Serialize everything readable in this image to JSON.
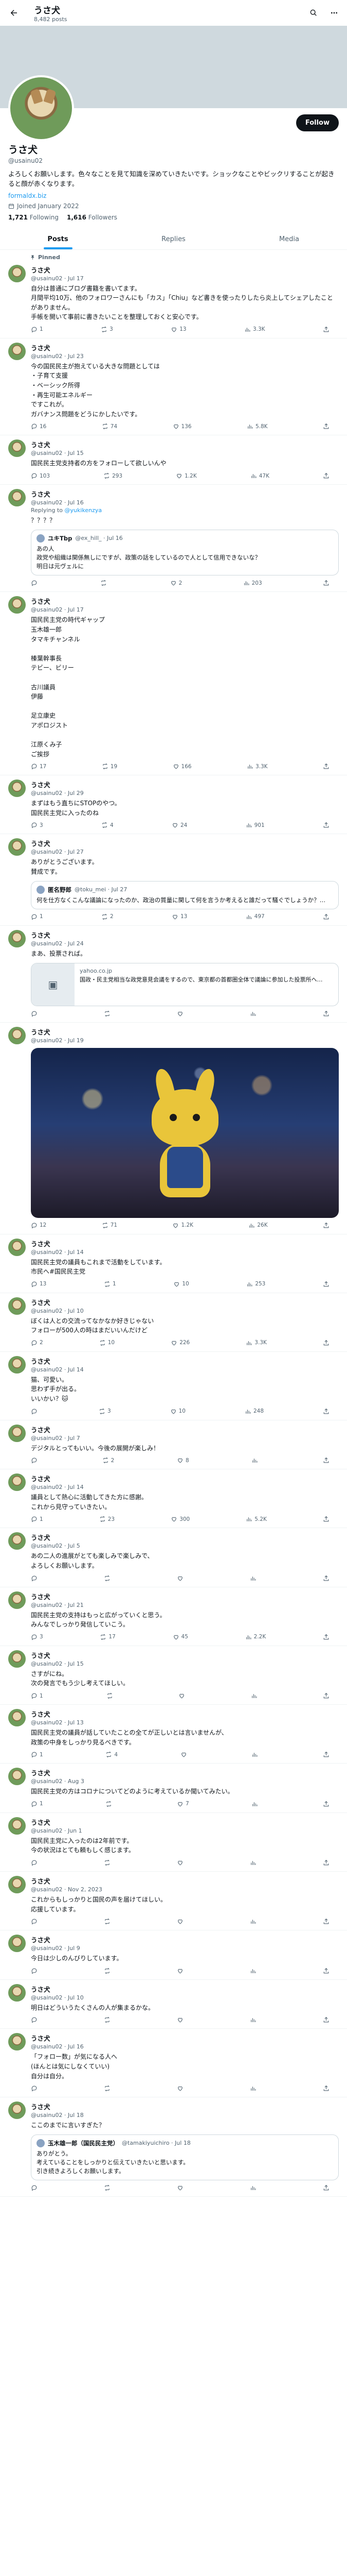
{
  "header": {
    "name": "うさ犬",
    "post_count": "8,482 posts"
  },
  "profile": {
    "display_name": "うさ犬",
    "handle": "@usainu02",
    "bio": "よろしくお願いします。色々なことを見て知識を深めていきたいです。ショックなことやビックリすることが起きると顔が赤くなります。",
    "link": "formaldx.biz",
    "joined": "Joined January 2022",
    "following_count": "1,721",
    "following_label": "Following",
    "followers_count": "1,616",
    "followers_label": "Followers",
    "follow_button": "Follow"
  },
  "tabs": [
    "Posts",
    "Replies",
    "Media"
  ],
  "pinned_label": "Pinned",
  "tweets": [
    {
      "name": "うさ犬",
      "meta": "@usainu02 · Jul 17",
      "text": "自分は普通にブログ書籍を書いてます。\n月間平均10万、他のフォロワーさんにも「カス」「Chiu」など書きを使ったりしたら炎上してシェアしたことがありません。\n手帳を開いて事前に書きたいことを整理しておくと安心です。",
      "replies": "1",
      "reposts": "3",
      "likes": "13",
      "views": "3.3K"
    },
    {
      "name": "うさ犬",
      "meta": "@usainu02 · Jul 23",
      "text": "今の国民民主が抱えている大きな問題としては\n・子育て支援\n・ベーシック所得\n・再生可能エネルギー\nですこれが。\nガバナンス問題をどうにかしたいです。",
      "replies": "16",
      "reposts": "74",
      "likes": "136",
      "views": "5.8K"
    },
    {
      "name": "うさ犬",
      "meta": "@usainu02 · Jul 15",
      "text": "国民民主党支持者の方をフォローして欲しいんや",
      "replies": "103",
      "reposts": "293",
      "likes": "1.2K",
      "views": "47K"
    },
    {
      "name": "うさ犬",
      "meta": "@usainu02 · Jul 16",
      "reply_to": "@yukikenzya",
      "text": "？？？？",
      "quote_name": "ユキTbp",
      "quote_meta": "@ex_hill_ · Jul 16",
      "quote_text": "あの人\n政党や組織は関係無しにですが、政策の話をしているので人として信用できないな？\n明日は元ヴェルに",
      "replies": "",
      "reposts": "",
      "likes": "2",
      "views": "203"
    },
    {
      "name": "うさ犬",
      "meta": "@usainu02 · Jul 17",
      "text": "国民民主党の時代ギャップ\n玉木雄一郎\nタマキチャンネル\n\n榛葉幹事長\nテビー、ビリー\n\n古川議員\n伊藤\n\n足立康史\nアポロジスト\n\n江原くみ子\nご挨拶",
      "replies": "17",
      "reposts": "19",
      "likes": "166",
      "views": "3.3K"
    },
    {
      "name": "うさ犬",
      "meta": "@usainu02 · Jul 29",
      "text": "まずはもう直ちにSTOPのやつ。\n国民民主党に入ったのね",
      "replies": "3",
      "reposts": "4",
      "likes": "24",
      "views": "901"
    },
    {
      "name": "うさ犬",
      "meta": "@usainu02 · Jul 27",
      "text": "ありがとうございます。\n賛成です。",
      "quote_name": "匿名野郎",
      "quote_meta": "@toku_mei · Jul 27",
      "quote_text": "何を仕方なくこんな議論になったのか、政治の質量に関して何を言うか考えると誰だって騒ぐでしょうか？…",
      "replies": "1",
      "reposts": "2",
      "likes": "13",
      "views": "497"
    },
    {
      "name": "うさ犬",
      "meta": "@usainu02 · Jul 24",
      "text": "まあ、投票されば。",
      "card_domain": "yahoo.co.jp",
      "card_title": "国政・民主党相当な政党意見会議をするので、東京都の首都圏全体で議論に参加した投票所へ…",
      "replies": "",
      "reposts": "",
      "likes": "",
      "views": ""
    },
    {
      "name": "うさ犬",
      "meta": "@usainu02 · Jul 19",
      "text": "",
      "has_media": true,
      "replies": "12",
      "reposts": "71",
      "likes": "1.2K",
      "views": "26K"
    },
    {
      "name": "うさ犬",
      "meta": "@usainu02 · Jul 14",
      "text": "国民民主党の議員もこれまで活動をしています。\n市民へ#国民民主党",
      "replies": "13",
      "reposts": "1",
      "likes": "10",
      "views": "253"
    },
    {
      "name": "うさ犬",
      "meta": "@usainu02 · Jul 10",
      "text": "ぼくは人との交流ってなかなか好きじゃない\nフォローが500人の時はまだいいんだけど",
      "replies": "2",
      "reposts": "10",
      "likes": "226",
      "views": "3.3K"
    },
    {
      "name": "うさ犬",
      "meta": "@usainu02 · Jul 14",
      "text": "猫、可愛い。\n思わず手が出る。\nいいかい？🐱",
      "replies": "",
      "reposts": "3",
      "likes": "10",
      "views": "248"
    },
    {
      "name": "うさ犬",
      "meta": "@usainu02 · Jul 7",
      "text": "デジタルとってもいい。今後の展開が楽しみ！",
      "replies": "",
      "reposts": "2",
      "likes": "8",
      "views": ""
    },
    {
      "name": "うさ犬",
      "meta": "@usainu02 · Jul 14",
      "text": "議員として熱心に活動してきた方に感謝。\nこれから見守っていきたい。",
      "replies": "1",
      "reposts": "23",
      "likes": "300",
      "views": "5.2K"
    },
    {
      "name": "うさ犬",
      "meta": "@usainu02 · Jul 5",
      "text": "あの二人の進展がとても楽しみで楽しみで、\nよろしくお願いします。",
      "replies": "",
      "reposts": "",
      "likes": "",
      "views": ""
    },
    {
      "name": "うさ犬",
      "meta": "@usainu02 · Jul 21",
      "text": "国民民主党の支持はもっと広がっていくと思う。\nみんなでしっかり発信していこう。",
      "replies": "3",
      "reposts": "17",
      "likes": "45",
      "views": "2.2K"
    },
    {
      "name": "うさ犬",
      "meta": "@usainu02 · Jul 15",
      "text": "さすがにね。\n次の発言でもう少し考えてほしい。",
      "replies": "1",
      "reposts": "",
      "likes": "",
      "views": ""
    },
    {
      "name": "うさ犬",
      "meta": "@usainu02 · Jul 13",
      "text": "国民民主党の議員が話していたことの全てが正しいとは言いませんが、\n政策の中身をしっかり見るべきです。",
      "replies": "1",
      "reposts": "4",
      "likes": "",
      "views": ""
    },
    {
      "name": "うさ犬",
      "meta": "@usainu02 · Aug 3",
      "text": "国民民主党の方はコロナについてどのように考えているか聞いてみたい。",
      "replies": "1",
      "reposts": "",
      "likes": "7",
      "views": ""
    },
    {
      "name": "うさ犬",
      "meta": "@usainu02 · Jun 1",
      "text": "国民民主党に入ったのは2年前です。\n今の状況はとても頼もしく感じます。",
      "replies": "",
      "reposts": "",
      "likes": "",
      "views": ""
    },
    {
      "name": "うさ犬",
      "meta": "@usainu02 · Nov 2, 2023",
      "text": "これからもしっかりと国民の声を届けてほしい。\n応援しています。",
      "replies": "",
      "reposts": "",
      "likes": "",
      "views": ""
    },
    {
      "name": "うさ犬",
      "meta": "@usainu02 · Jul 9",
      "text": "今日は少しのんびりしています。",
      "replies": "",
      "reposts": "",
      "likes": "",
      "views": ""
    },
    {
      "name": "うさ犬",
      "meta": "@usainu02 · Jul 10",
      "text": "明日はどういうたくさんの人が集まるかな。",
      "replies": "",
      "reposts": "",
      "likes": "",
      "views": ""
    },
    {
      "name": "うさ犬",
      "meta": "@usainu02 · Jul 16",
      "text": "「フォロー数」が気になる人へ\n(ほんとは気にしなくていい)\n自分は自分。",
      "replies": "",
      "reposts": "",
      "likes": "",
      "views": ""
    },
    {
      "name": "うさ犬",
      "meta": "@usainu02 · Jul 18",
      "text": "ここのまでに言いすぎた？",
      "quote_name": "玉木雄一郎（国民民主党）",
      "quote_meta": "@tamakiyuichiro · Jul 18",
      "quote_text": "ありがとう。\n考えていることをしっかりと伝えていきたいと思います。\n引き続きよろしくお願いします。",
      "replies": "",
      "reposts": "",
      "likes": "",
      "views": ""
    }
  ],
  "icons": {
    "back": "arrow-left-icon",
    "search": "search-icon",
    "more": "more-icon",
    "reply": "reply-icon",
    "repost": "repost-icon",
    "like": "heart-icon",
    "views": "views-icon",
    "share": "share-icon",
    "pin": "pin-icon",
    "calendar": "calendar-icon"
  },
  "colors": {
    "accent": "#1d9bf0",
    "text": "#0f1419",
    "muted": "#536471",
    "border": "#eff3f4"
  }
}
